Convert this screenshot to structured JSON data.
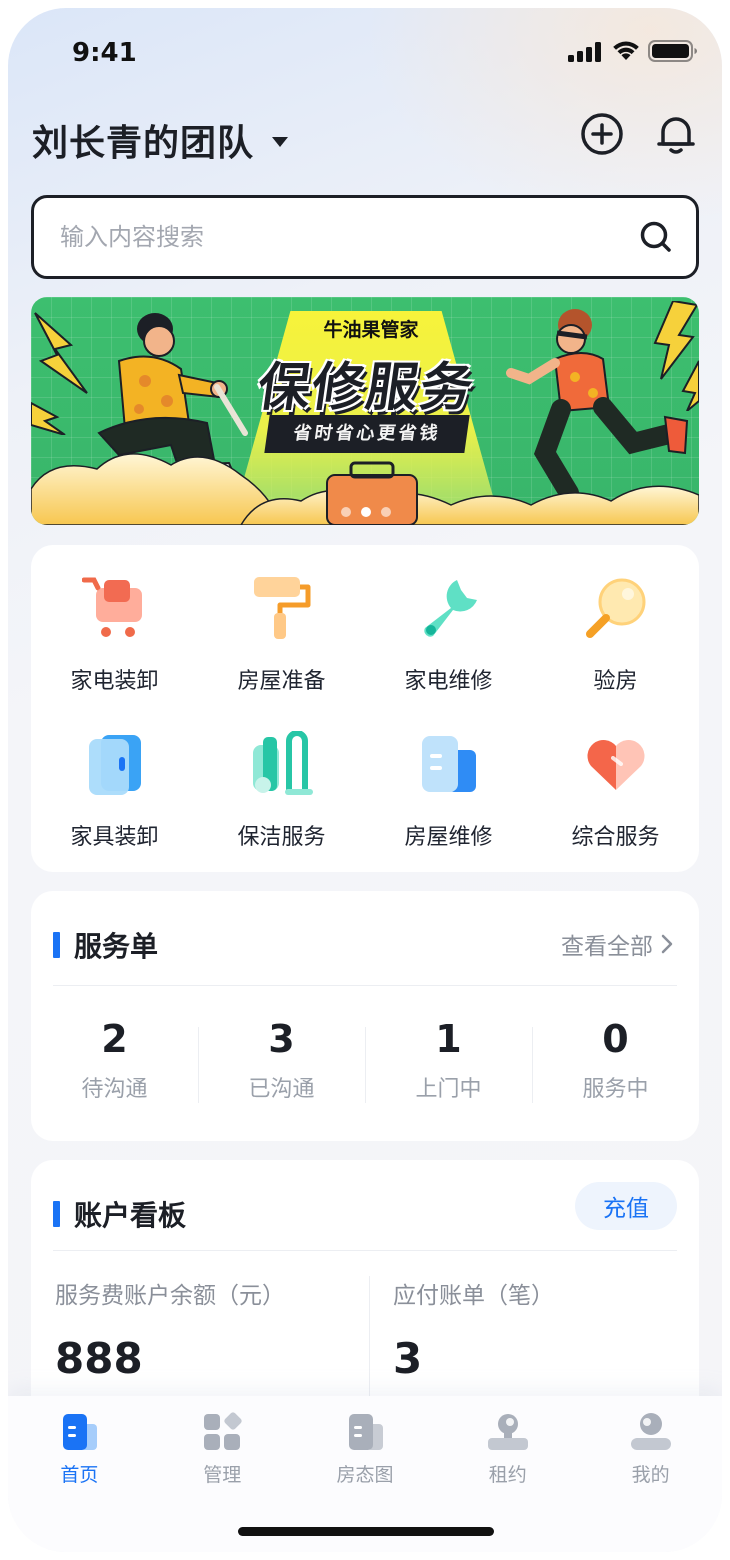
{
  "status_bar": {
    "time": "9:41"
  },
  "header": {
    "team_name": "刘长青的团队"
  },
  "search": {
    "placeholder": "输入内容搜索"
  },
  "banner": {
    "brand": "牛油果管家",
    "title": "保修服务",
    "subtitle": "省时省心更省钱",
    "slide_count": 3,
    "active_slide": 1
  },
  "services": [
    {
      "label": "家电装卸",
      "icon": "cart-icon"
    },
    {
      "label": "房屋准备",
      "icon": "paint-roller-icon"
    },
    {
      "label": "家电维修",
      "icon": "wrench-icon"
    },
    {
      "label": "验房",
      "icon": "magnifier-icon"
    },
    {
      "label": "家具装卸",
      "icon": "wardrobe-icon"
    },
    {
      "label": "保洁服务",
      "icon": "cleaning-icon"
    },
    {
      "label": "房屋维修",
      "icon": "building-icon"
    },
    {
      "label": "综合服务",
      "icon": "heart-icon"
    }
  ],
  "orders": {
    "title": "服务单",
    "view_all": "查看全部",
    "stats": [
      {
        "value": "2",
        "label": "待沟通"
      },
      {
        "value": "3",
        "label": "已沟通"
      },
      {
        "value": "1",
        "label": "上门中"
      },
      {
        "value": "0",
        "label": "服务中"
      }
    ]
  },
  "account": {
    "title": "账户看板",
    "recharge": "充值",
    "balance_label": "服务费账户余额（元）",
    "balance_value": "888",
    "bills_label": "应付账单（笔）",
    "bills_value": "3"
  },
  "tabbar": [
    {
      "label": "首页",
      "icon": "home-icon",
      "active": true
    },
    {
      "label": "管理",
      "icon": "grid-icon",
      "active": false
    },
    {
      "label": "房态图",
      "icon": "building-icon",
      "active": false
    },
    {
      "label": "租约",
      "icon": "stamp-icon",
      "active": false
    },
    {
      "label": "我的",
      "icon": "profile-icon",
      "active": false
    }
  ],
  "colors": {
    "accent": "#1a73f5",
    "text": "#1c1f26",
    "muted": "#9aa0aa",
    "banner_green": "#3dbf6f",
    "banner_yellow": "#f7f33a"
  }
}
